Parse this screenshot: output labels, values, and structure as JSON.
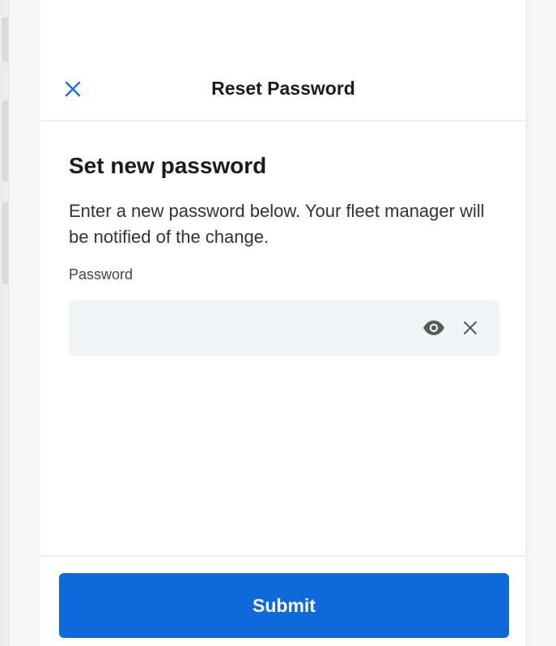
{
  "header": {
    "title": "Reset Password",
    "close_icon": "close-icon"
  },
  "content": {
    "heading": "Set new password",
    "description": "Enter a new password below. Your fleet manager will be notified of the change.",
    "password_label": "Password",
    "password_value": "",
    "password_placeholder": ""
  },
  "icons": {
    "show_password": "eye-icon",
    "clear": "clear-icon"
  },
  "footer": {
    "submit_label": "Submit"
  },
  "colors": {
    "accent": "#0f6ad9",
    "close_icon": "#1a73e8",
    "input_bg": "#f2f4f5",
    "text": "#1c1c1c"
  }
}
